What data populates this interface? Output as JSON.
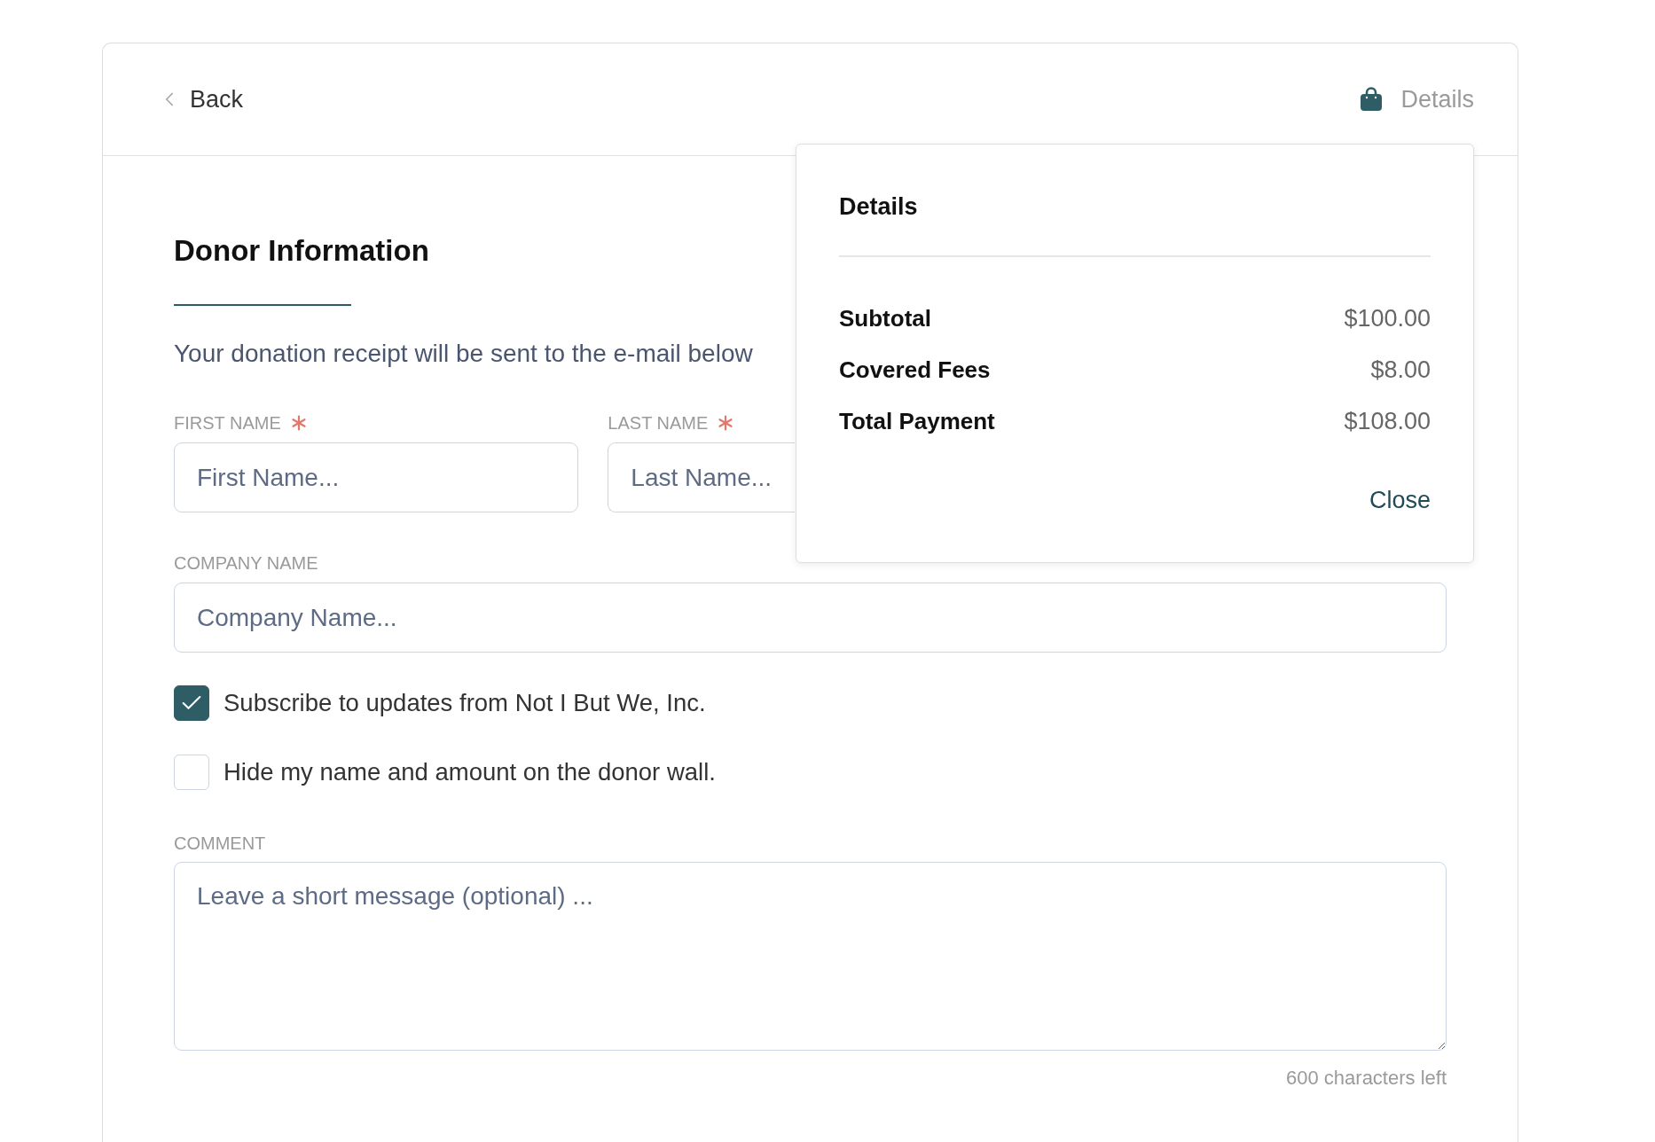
{
  "header": {
    "back": {
      "label": "Back"
    },
    "details": {
      "label": "Details"
    }
  },
  "section": {
    "title": "Donor Information",
    "note": "Your donation receipt will be sent to the e-mail below"
  },
  "name_fields": [
    {
      "label": "FIRST NAME",
      "required": true,
      "placeholder": "First Name..."
    },
    {
      "label": "LAST NAME",
      "required": true,
      "placeholder": "Last Name..."
    }
  ],
  "company_field": {
    "label": "COMPANY NAME",
    "required": false,
    "placeholder": "Company Name..."
  },
  "options": [
    {
      "label": "Subscribe to updates from Not I But We, Inc.",
      "checked": true
    },
    {
      "label": "Hide my name and amount on the donor wall.",
      "checked": false
    }
  ],
  "comment_field": {
    "label": "COMMENT",
    "required": false,
    "placeholder": "Leave a short message (optional) ...",
    "counter": "600 characters left"
  },
  "details_popover": {
    "title": "Details",
    "rows": [
      {
        "label": "Subtotal",
        "value": "$100.00"
      },
      {
        "label": "Covered Fees",
        "value": "$8.00"
      },
      {
        "label": "Total Payment",
        "value": "$108.00"
      }
    ],
    "close": "Close"
  }
}
